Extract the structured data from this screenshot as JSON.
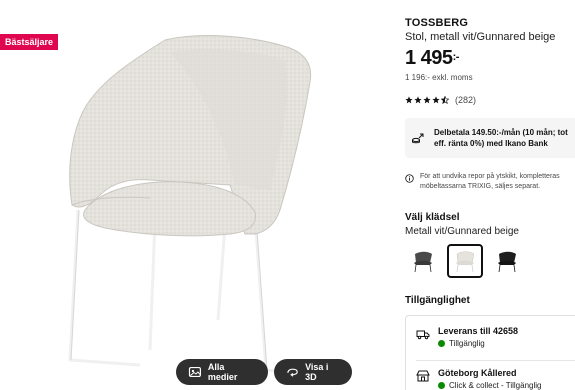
{
  "badge": "Bästsäljare",
  "media": {
    "all_media_label": "Alla medier",
    "view_3d_label": "Visa i 3D"
  },
  "product": {
    "name": "TOSSBERG",
    "description": "Stol, metall vit/Gunnared beige",
    "price_main": "1 495",
    "price_suffix": ":-",
    "price_ex_vat": "1 196:- exkl. moms",
    "rating_count": "(282)",
    "rating_value": 4.5
  },
  "finance": {
    "line1": "Delbetala 149.50:-/mån (10 mån; tot",
    "line2": "eff. ränta 0%) med Ikano Bank"
  },
  "notice": "För att undvika repor på ytskikt, kompletteras möbeltassarna TRIXIG, säljes separat.",
  "upholstery": {
    "title": "Välj klädsel",
    "selected": "Metall vit/Gunnared beige",
    "swatches": [
      "metall-svart-gra",
      "metall-vit-beige",
      "metall-svart"
    ]
  },
  "availability": {
    "title": "Tillgänglighet",
    "delivery_title": "Leverans till 42658",
    "delivery_status": "Tillgänglig",
    "store_title": "Göteborg Kållered",
    "store_status": "Click & collect - Tillgänglig"
  },
  "colors": {
    "badge": "#e00751",
    "available": "#0a8a00",
    "button_dark": "#2f2f2f"
  }
}
